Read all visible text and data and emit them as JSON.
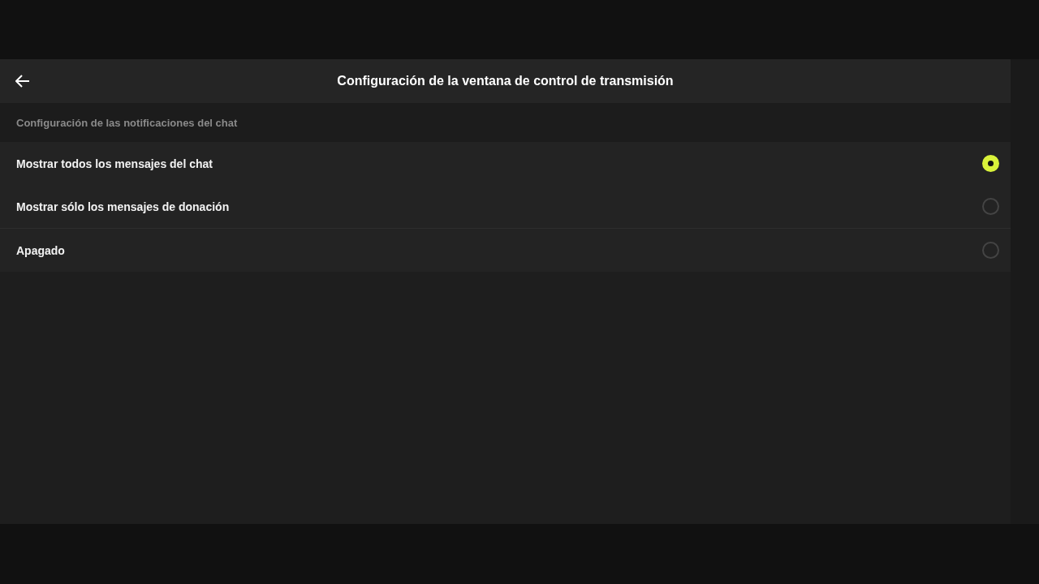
{
  "header": {
    "title": "Configuración de la ventana de control de transmisión"
  },
  "section": {
    "title": "Configuración de las notificaciones del chat",
    "options": [
      {
        "label": "Mostrar todos los mensajes del chat",
        "selected": true
      },
      {
        "label": "Mostrar sólo los mensajes de donación",
        "selected": false
      },
      {
        "label": "Apagado",
        "selected": false
      }
    ]
  }
}
